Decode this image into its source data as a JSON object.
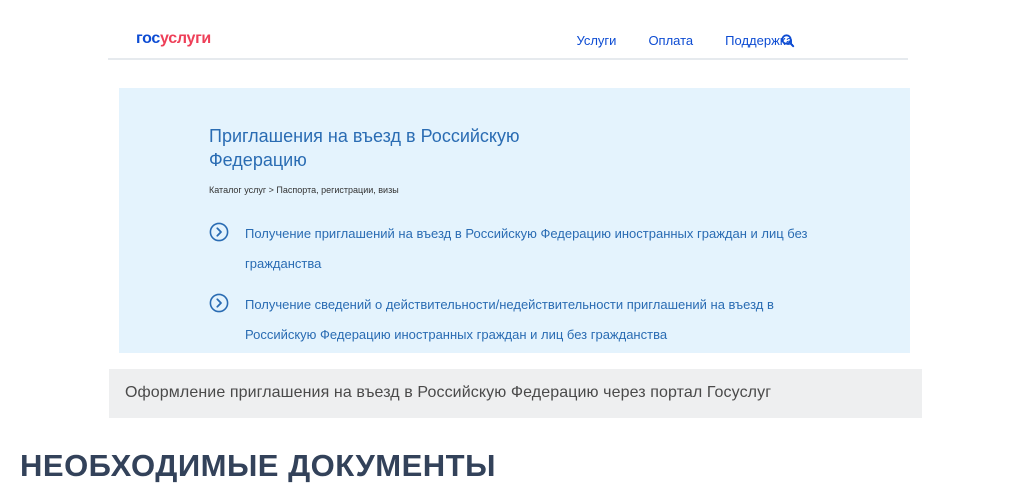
{
  "header": {
    "logo": {
      "part1": "гос",
      "part2": "услуги"
    },
    "nav": [
      "Услуги",
      "Оплата",
      "Поддержка"
    ],
    "search_icon": "search-icon"
  },
  "panel": {
    "title": "Приглашения на въезд в Российскую Федерацию",
    "breadcrumb": "Каталог услуг > Паспорта, регистрации, визы",
    "links": [
      "Получение приглашений на въезд в Российскую Федерацию иностранных граждан и лиц без гражданства",
      "Получение сведений о действительности/недействительности приглашений на въезд в Российскую Федерацию иностранных граждан и лиц без гражданства"
    ],
    "link_icon": "chevron-circle-icon"
  },
  "caption": "Оформление приглашения на въезд в Российскую Федерацию через портал Госуслуг",
  "heading": "НЕОБХОДИМЫЕ ДОКУМЕНТЫ",
  "colors": {
    "brand_blue": "#0d4cd3",
    "brand_red": "#ee3f58",
    "link_blue": "#2a6cb3",
    "panel_bg": "#e4f3fd",
    "caption_bg": "#eeeff0",
    "heading": "#33425a"
  }
}
